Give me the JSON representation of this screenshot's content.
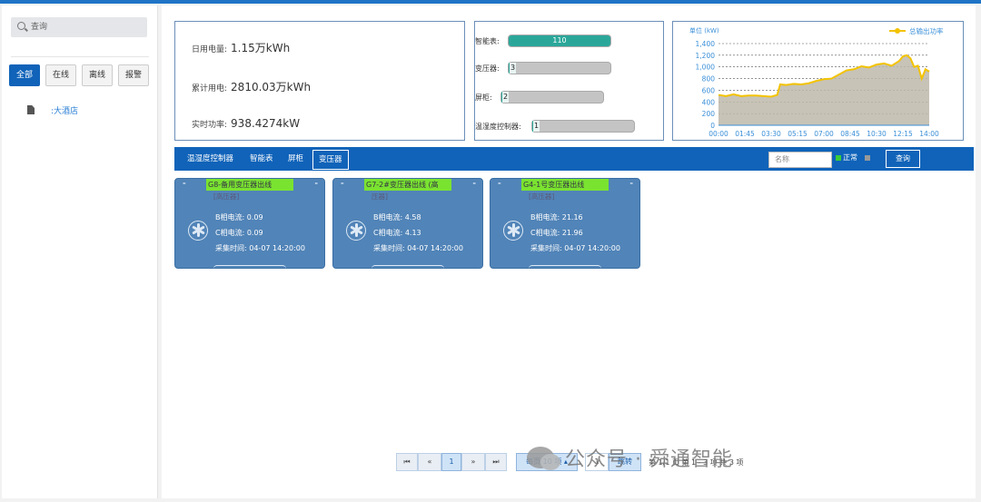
{
  "sidebar": {
    "search_placeholder": "查询",
    "filters": [
      "全部",
      "在线",
      "离线",
      "报警"
    ],
    "tree_item": ":大酒店"
  },
  "stats": {
    "daily_label": "日用电量:",
    "daily_value": "1.15万kWh",
    "total_label": "累计用电:",
    "total_value": "2810.03万kWh",
    "power_label": "实时功率:",
    "power_value": "938.4274kW"
  },
  "device_bars": [
    {
      "label": "智能表:",
      "value": "110",
      "fill": 1.0
    },
    {
      "label": "变压器:",
      "value": "3",
      "fill": 0.03
    },
    {
      "label": "屏柜:",
      "value": "2",
      "fill": 0.02
    },
    {
      "label": "温湿度控制器:",
      "value": "1",
      "fill": 0.01
    }
  ],
  "chart_data": {
    "type": "area",
    "unit_label": "单位 (kW)",
    "legend": "总输出功率",
    "x_ticks": [
      "00:00",
      "01:45",
      "03:30",
      "05:15",
      "07:00",
      "08:45",
      "10:30",
      "12:15",
      "14:00"
    ],
    "y_ticks": [
      "0",
      "200",
      "400",
      "600",
      "800",
      "1,000",
      "1,200",
      "1,400"
    ],
    "ylim": [
      0,
      1400
    ],
    "xlim": [
      0,
      14
    ],
    "x": [
      0,
      0.5,
      1,
      1.5,
      2,
      2.5,
      3,
      3.5,
      3.9,
      4.1,
      4.5,
      5,
      5.5,
      6,
      6.5,
      7,
      7.5,
      8,
      8.5,
      9,
      9.5,
      10,
      10.5,
      11,
      11.5,
      12,
      12.25,
      12.5,
      12.75,
      13,
      13.25,
      13.5,
      13.75,
      14
    ],
    "y": [
      520,
      500,
      530,
      500,
      510,
      510,
      500,
      490,
      520,
      700,
      690,
      710,
      700,
      720,
      760,
      790,
      800,
      870,
      940,
      960,
      1010,
      990,
      1040,
      1060,
      1020,
      1100,
      1180,
      1200,
      1150,
      1000,
      1020,
      800,
      960,
      920
    ],
    "fill_color": "#bdb8aa",
    "line_color": "#f3c300",
    "grid": true
  },
  "tabs": [
    "温湿度控制器",
    "智能表",
    "屏柜",
    "变压器"
  ],
  "toolbar": {
    "name_placeholder": "名称",
    "normal_label": "正常",
    "query_label": "查询"
  },
  "cards": [
    {
      "title": "G8-备用变压器出线",
      "subtitle": "[高压器]",
      "b_label": "B相电流:",
      "b_value": "0.09",
      "c_label": "C相电流:",
      "c_value": "0.09",
      "t_label": "采集时间:",
      "t_value": "04-07 14:20:00"
    },
    {
      "title": "G7-2#变压器出线 (高",
      "subtitle": "压器]",
      "b_label": "B相电流:",
      "b_value": "4.58",
      "c_label": "C相电流:",
      "c_value": "4.13",
      "t_label": "采集时间:",
      "t_value": "04-07 14:20:00"
    },
    {
      "title": "G4-1号变压器出线",
      "subtitle": "[高压器]",
      "b_label": "B相电流:",
      "b_value": "21.16",
      "c_label": "C相电流:",
      "c_value": "21.96",
      "t_label": "采集时间:",
      "t_value": "04-07 14:20:00"
    }
  ],
  "pager": {
    "first": "⏮",
    "prev": "«",
    "page": "1",
    "next": "»",
    "last": "⏭",
    "page_size": "每页 10 项 ▴",
    "jump_value": "1",
    "jump_label": "跳转",
    "info": "第 1/1 页  第 1 - 3 项  共 3 项"
  },
  "watermark": "公众号 · 舜通智能"
}
